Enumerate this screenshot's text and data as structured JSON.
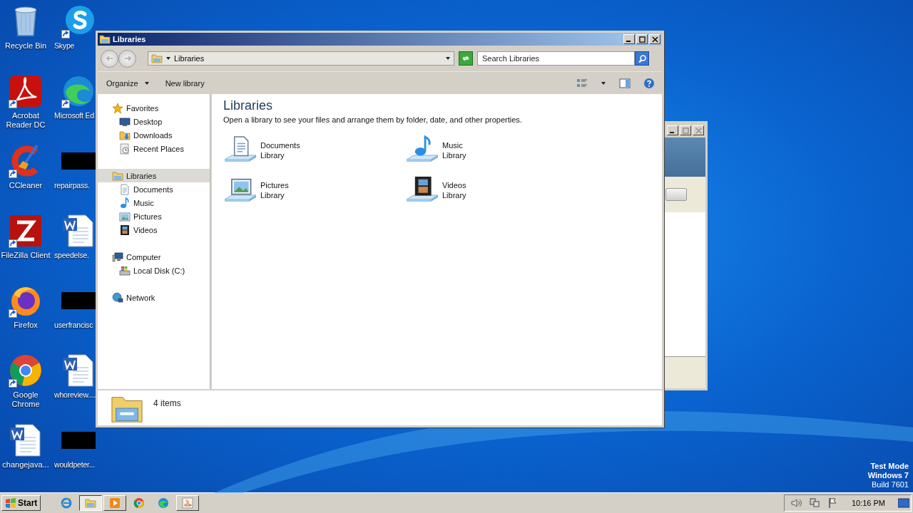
{
  "desktop_icons": [
    {
      "label": "Recycle Bin",
      "kind": "recycle",
      "shortcut": false
    },
    {
      "label": "Skype",
      "kind": "skype",
      "shortcut": true
    },
    {
      "label": "Acrobat Reader DC",
      "kind": "acrobat",
      "shortcut": true
    },
    {
      "label": "Microsoft Ed",
      "kind": "edge",
      "shortcut": true
    },
    {
      "label": "CCleaner",
      "kind": "ccleaner",
      "shortcut": true
    },
    {
      "label": "repairpass.",
      "kind": "redacted",
      "shortcut": false
    },
    {
      "label": "FileZilla Client",
      "kind": "filezilla",
      "shortcut": true
    },
    {
      "label": "speedelse.",
      "kind": "word",
      "shortcut": false
    },
    {
      "label": "Firefox",
      "kind": "firefox",
      "shortcut": true
    },
    {
      "label": "userfrancisc",
      "kind": "redacted",
      "shortcut": false
    },
    {
      "label": "Google Chrome",
      "kind": "chrome",
      "shortcut": true
    },
    {
      "label": "whoreview....",
      "kind": "word",
      "shortcut": false
    },
    {
      "label": "changejava...",
      "kind": "word",
      "shortcut": false
    },
    {
      "label": "wouldpeter...",
      "kind": "redacted",
      "shortcut": false
    }
  ],
  "explorer": {
    "title": "Libraries",
    "address": "Libraries",
    "search": {
      "placeholder": "Search Libraries"
    },
    "commands": [
      "Organize",
      "New library"
    ],
    "nav": [
      {
        "label": "Favorites",
        "kind": "star",
        "selected": false,
        "children": [
          {
            "label": "Desktop",
            "kind": "desktop",
            "selected": false
          },
          {
            "label": "Downloads",
            "kind": "downloads",
            "selected": false
          },
          {
            "label": "Recent Places",
            "kind": "recent",
            "selected": false
          }
        ]
      },
      {
        "label": "Libraries",
        "kind": "libraries",
        "selected": true,
        "children": [
          {
            "label": "Documents",
            "kind": "documents",
            "selected": false
          },
          {
            "label": "Music",
            "kind": "music",
            "selected": false
          },
          {
            "label": "Pictures",
            "kind": "pictures",
            "selected": false
          },
          {
            "label": "Videos",
            "kind": "videos",
            "selected": false
          }
        ]
      },
      {
        "label": "Computer",
        "kind": "computer",
        "selected": false,
        "children": [
          {
            "label": "Local Disk (C:)",
            "kind": "disk",
            "selected": false
          }
        ]
      },
      {
        "label": "Network",
        "kind": "network",
        "selected": false
      }
    ],
    "heading": "Libraries",
    "description": "Open a library to see your files and arrange them by folder, date, and other properties.",
    "libraries": [
      {
        "name": "Documents",
        "type": "Library",
        "kind": "documents"
      },
      {
        "name": "Music",
        "type": "Library",
        "kind": "music"
      },
      {
        "name": "Pictures",
        "type": "Library",
        "kind": "pictures"
      },
      {
        "name": "Videos",
        "type": "Library",
        "kind": "videos"
      }
    ],
    "status": "4 items"
  },
  "taskbar": {
    "start": "Start",
    "apps": [
      {
        "kind": "ie",
        "open": false,
        "selected": false
      },
      {
        "kind": "explorer",
        "open": true,
        "selected": true
      },
      {
        "kind": "media",
        "open": true,
        "selected": false
      },
      {
        "kind": "chrome",
        "open": false,
        "selected": false
      },
      {
        "kind": "edge",
        "open": false,
        "selected": false
      },
      {
        "kind": "java",
        "open": true,
        "selected": false
      }
    ],
    "time": "10:16 PM"
  },
  "system_notice": [
    "Test Mode",
    "Windows 7",
    "Build 7601"
  ]
}
